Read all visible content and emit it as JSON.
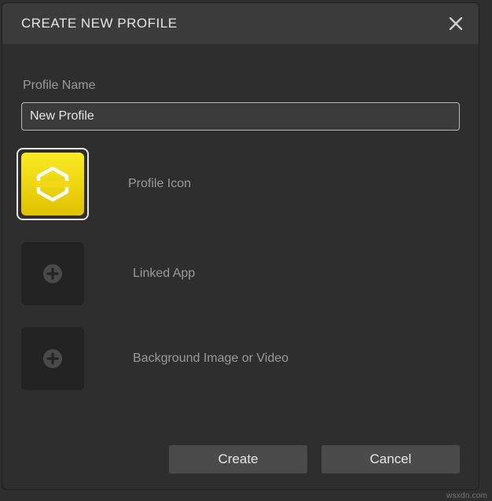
{
  "dialog": {
    "title": "CREATE NEW PROFILE"
  },
  "fields": {
    "profileName": {
      "label": "Profile Name",
      "value": "New Profile"
    },
    "profileIcon": {
      "label": "Profile Icon"
    },
    "linkedApp": {
      "label": "Linked App"
    },
    "background": {
      "label": "Background Image or Video"
    }
  },
  "buttons": {
    "create": "Create",
    "cancel": "Cancel"
  },
  "watermark": "wsxdn.com",
  "colors": {
    "accent_yellow_top": "#f9ea23",
    "accent_yellow_bottom": "#e0c200",
    "panel": "#3b3b3b",
    "bg": "#2e2e2e"
  },
  "icons": {
    "close": "close-icon",
    "hexagon": "hexagon-outline-icon",
    "plus_circle": "plus-circle-icon"
  }
}
